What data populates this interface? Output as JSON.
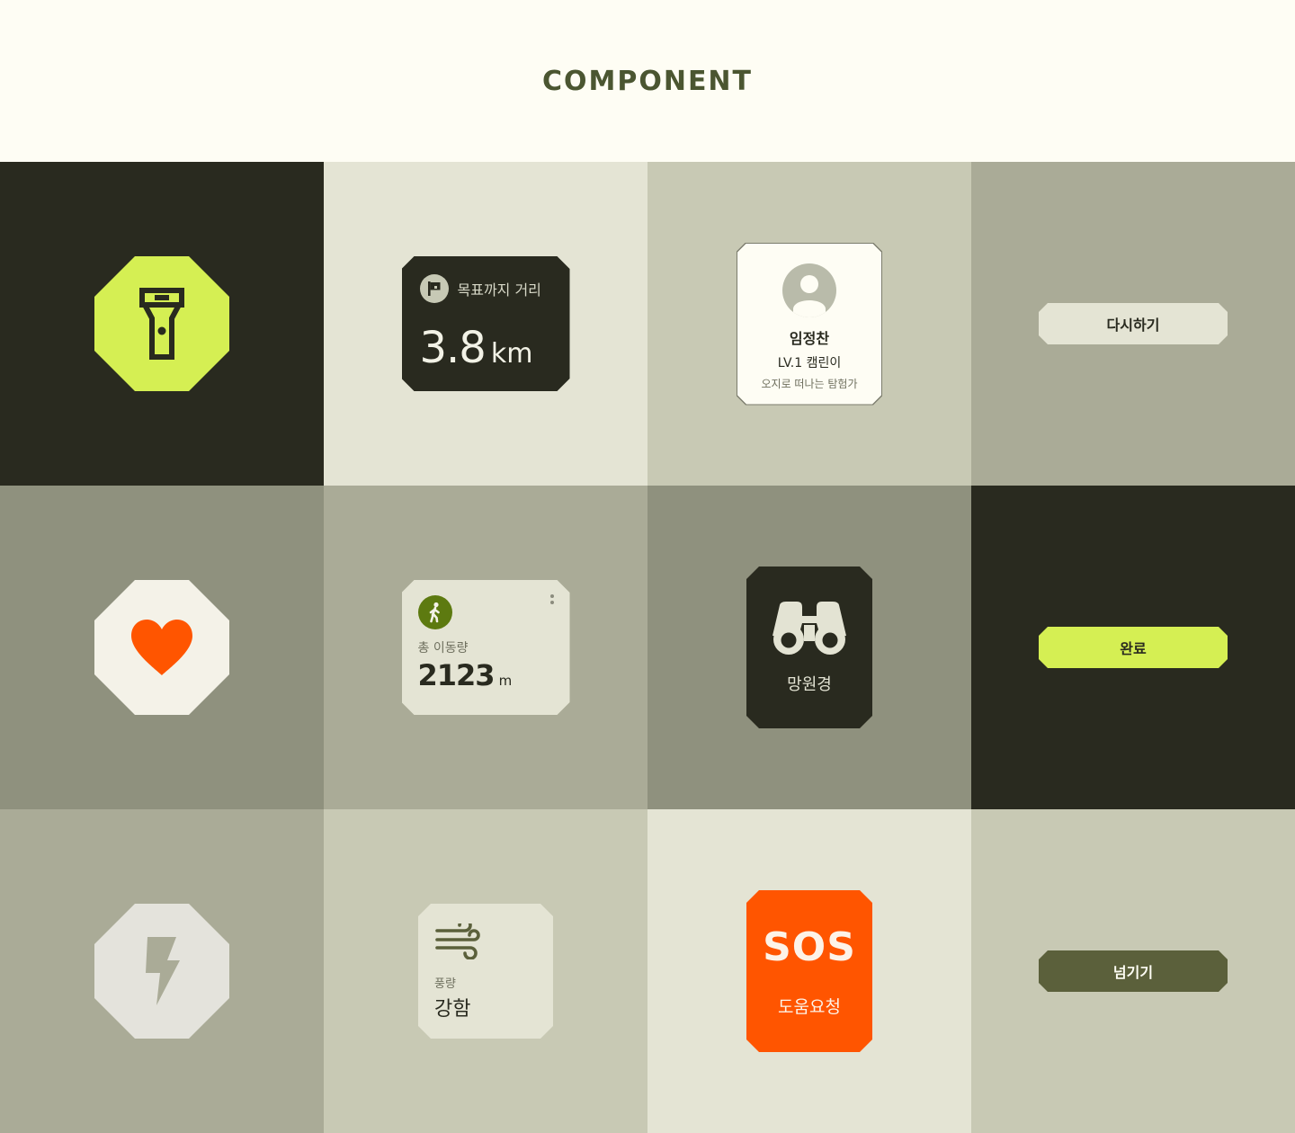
{
  "page": {
    "title": "COMPONENT"
  },
  "colors": {
    "dark": "#292a1f",
    "lime": "#d5ef53",
    "orange": "#ff5500",
    "olive": "#5b603b",
    "cream": "#fefdf4"
  },
  "tiles": {
    "flashlight": {
      "icon": "flashlight-icon"
    },
    "heart": {
      "icon": "heart-icon"
    },
    "flash": {
      "icon": "lightning-icon"
    }
  },
  "distance_card": {
    "icon": "flag-icon",
    "label": "목표까지 거리",
    "value": "3.8",
    "unit": "km"
  },
  "profile_card": {
    "name": "임정찬",
    "level": "LV.1 캠린이",
    "description": "오지로 떠나는 탐험가"
  },
  "buttons": {
    "retry": "다시하기",
    "done": "완료",
    "skip": "넘기기"
  },
  "steps_card": {
    "icon": "walking-icon",
    "label": "총 이동량",
    "value": "2123",
    "unit": "m"
  },
  "binoculars_tile": {
    "icon": "binoculars-icon",
    "label": "망원경"
  },
  "wind_card": {
    "icon": "wind-icon",
    "label": "풍량",
    "value": "강함"
  },
  "sos_tile": {
    "title": "SOS",
    "label": "도움요청"
  }
}
